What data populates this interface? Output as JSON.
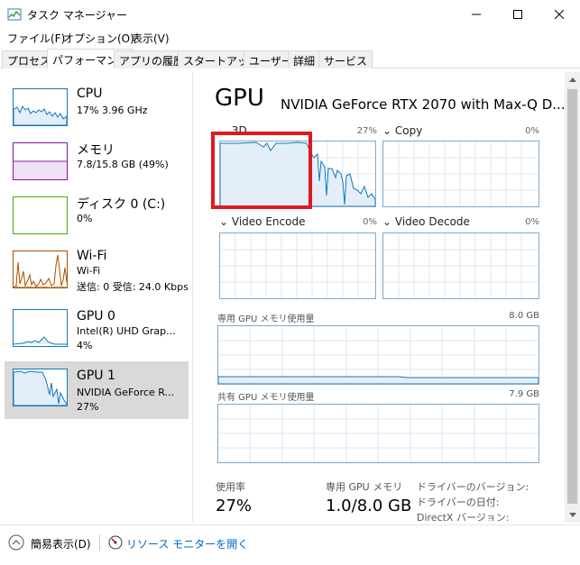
{
  "window": {
    "title": "タスク マネージャー",
    "icon": "task-manager-icon"
  },
  "menu": [
    "ファイル(F)",
    "オプション(O)",
    "表示(V)"
  ],
  "tabs": [
    {
      "label": "プロセス",
      "active": false
    },
    {
      "label": "パフォーマンス",
      "active": true
    },
    {
      "label": "アプリの履歴",
      "active": false
    },
    {
      "label": "スタートアップ",
      "active": false
    },
    {
      "label": "ユーザー",
      "active": false
    },
    {
      "label": "詳細",
      "active": false
    },
    {
      "label": "サービス",
      "active": false
    }
  ],
  "sidebar": [
    {
      "title": "CPU",
      "sub1": "17%  3.96 GHz",
      "sub2": "",
      "color": "#1177bb"
    },
    {
      "title": "メモリ",
      "sub1": "7.8/15.8 GB (49%)",
      "sub2": "",
      "color": "#8b12ae"
    },
    {
      "title": "ディスク 0 (C:)",
      "sub1": "0%",
      "sub2": "",
      "color": "#4da60c"
    },
    {
      "title": "Wi-Fi",
      "sub1": "Wi-Fi",
      "sub2": "送信: 0  受信: 24.0 Kbps",
      "color": "#a74f01"
    },
    {
      "title": "GPU 0",
      "sub1": "Intel(R) UHD Grap...",
      "sub2": "4%",
      "color": "#1177bb"
    },
    {
      "title": "GPU 1",
      "sub1": "NVIDIA GeForce R...",
      "sub2": "27%",
      "color": "#1177bb"
    }
  ],
  "main": {
    "title": "GPU",
    "device_name": "NVIDIA GeForce RTX 2070 with Max-Q D...",
    "engines": [
      {
        "label": "3D",
        "pct": "27%"
      },
      {
        "label": "Copy",
        "pct": "0%"
      },
      {
        "label": "Video Encode",
        "pct": "0%"
      },
      {
        "label": "Video Decode",
        "pct": "0%"
      }
    ],
    "dedicated_label": "専用 GPU メモリ使用量",
    "dedicated_max": "8.0 GB",
    "shared_label": "共有 GPU メモリ使用量",
    "shared_max": "7.9 GB",
    "stats": {
      "usage_label": "使用率",
      "usage_value": "27%",
      "dedicated_mem_label": "専用 GPU メモリ",
      "dedicated_mem_value": "1.0/8.0 GB"
    },
    "driver": {
      "version_label": "ドライバーのバージョン:",
      "date_label": "ドライバーの日付:",
      "directx_label": "DirectX バージョン:"
    }
  },
  "footer": {
    "brief_label": "簡易表示(D)",
    "resmon_label": "リソース モニターを開く"
  },
  "colors": {
    "accent": "#1177bb",
    "graph_border": "#7ea9c9",
    "highlight_box": "#e0191f",
    "link": "#0066cc"
  }
}
